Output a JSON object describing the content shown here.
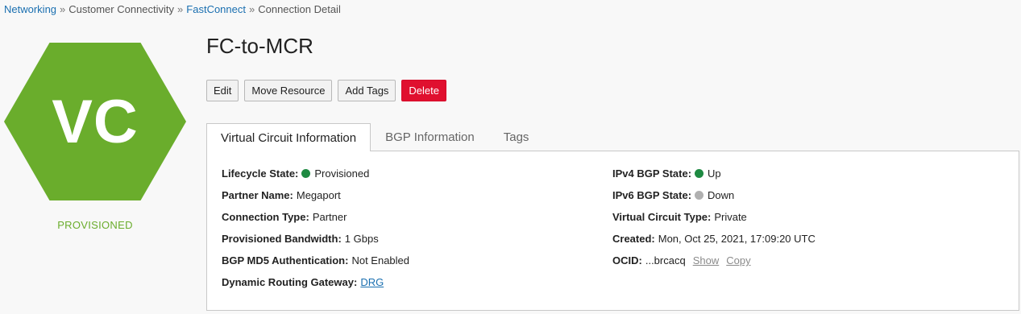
{
  "breadcrumb": {
    "items": [
      "Networking",
      "Customer Connectivity",
      "FastConnect",
      "Connection Detail"
    ],
    "separator": "»"
  },
  "badge": {
    "initials": "VC",
    "color": "#6aad2c",
    "status": "PROVISIONED"
  },
  "title": "FC-to-MCR",
  "toolbar": {
    "edit_label": "Edit",
    "move_label": "Move Resource",
    "tags_label": "Add Tags",
    "delete_label": "Delete"
  },
  "tabs": [
    {
      "label": "Virtual Circuit Information",
      "active": true
    },
    {
      "label": "BGP Information",
      "active": false
    },
    {
      "label": "Tags",
      "active": false
    }
  ],
  "details": {
    "left": {
      "lifecycle_label": "Lifecycle State:",
      "lifecycle_value": "Provisioned",
      "lifecycle_status_color": "#1e8a42",
      "partner_label": "Partner Name:",
      "partner_value": "Megaport",
      "conn_type_label": "Connection Type:",
      "conn_type_value": "Partner",
      "bandwidth_label": "Provisioned Bandwidth:",
      "bandwidth_value": "1 Gbps",
      "md5_label": "BGP MD5 Authentication:",
      "md5_value": "Not Enabled",
      "drg_label": "Dynamic Routing Gateway:",
      "drg_value": "DRG"
    },
    "right": {
      "ipv4_label": "IPv4 BGP State:",
      "ipv4_value": "Up",
      "ipv4_status_color": "#1e8a42",
      "ipv6_label": "IPv6 BGP State:",
      "ipv6_value": "Down",
      "ipv6_status_color": "#b0b0b0",
      "vc_type_label": "Virtual Circuit Type:",
      "vc_type_value": "Private",
      "created_label": "Created:",
      "created_value": "Mon, Oct 25, 2021, 17:09:20 UTC",
      "ocid_label": "OCID:",
      "ocid_value": "...brcacq",
      "show_label": "Show",
      "copy_label": "Copy"
    }
  }
}
